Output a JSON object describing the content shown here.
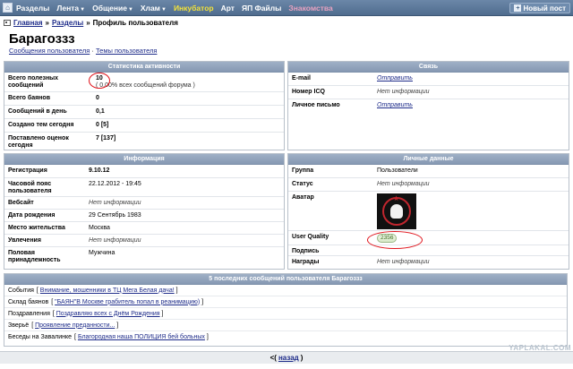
{
  "nav": {
    "items": [
      {
        "label": "Разделы",
        "caret": false,
        "style": "normal"
      },
      {
        "label": "Лента",
        "caret": true,
        "style": "normal"
      },
      {
        "label": "Общение",
        "caret": true,
        "style": "normal"
      },
      {
        "label": "Хлам",
        "caret": true,
        "style": "normal"
      },
      {
        "label": "Инкубатор",
        "caret": false,
        "style": "yellow"
      },
      {
        "label": "Арт",
        "caret": false,
        "style": "normal"
      },
      {
        "label": "ЯП Файлы",
        "caret": false,
        "style": "normal"
      },
      {
        "label": "Знакомства",
        "caret": false,
        "style": "pink"
      }
    ],
    "new_post": "Новый пост"
  },
  "breadcrumb": {
    "home": "Главная",
    "sections": "Разделы",
    "current": "Профиль пользователя",
    "separator": "»"
  },
  "profile": {
    "name": "Барагоззз",
    "tab_messages": "Сообщения пользователя",
    "tab_divider": "·",
    "tab_topics": "Темы пользователя"
  },
  "stats": {
    "title": "Статистика активности",
    "rows": [
      {
        "label": "Всего полезных сообщений",
        "value": "10",
        "extra": "( 0.00% всех сообщений форума )"
      },
      {
        "label": "Всего баянов",
        "value": "0"
      },
      {
        "label": "Сообщений в день",
        "value": "0,1"
      },
      {
        "label": "Создано тем сегодня",
        "value": "0 [5]"
      },
      {
        "label": "Поставлено оценок сегодня",
        "value": "7 [137]"
      }
    ]
  },
  "contact": {
    "title": "Связь",
    "rows": [
      {
        "label": "E-mail",
        "value": "Отправить",
        "link": true
      },
      {
        "label": "Номер ICQ",
        "value": "Нет информации",
        "link": false
      },
      {
        "label": "Личное письмо",
        "value": "Отправить",
        "link": true
      }
    ]
  },
  "info": {
    "title": "Информация",
    "rows": [
      {
        "label": "Регистрация",
        "value": "9.10.12",
        "bold": true
      },
      {
        "label": "Часовой пояс пользователя",
        "value": "22.12.2012 - 19:45"
      },
      {
        "label": "Вебсайт",
        "value": "Нет информации",
        "muted": true
      },
      {
        "label": "Дата рождения",
        "value": "29 Сентябрь 1983"
      },
      {
        "label": "Место жительства",
        "value": "Москва"
      },
      {
        "label": "Увлечения",
        "value": "Нет информации",
        "muted": true
      },
      {
        "label": "Половая принадлежность",
        "value": "Мужчина"
      }
    ]
  },
  "personal": {
    "title": "Личные данные",
    "group_label": "Группа",
    "group_value": "Пользователи",
    "status_label": "Статус",
    "status_value": "Нет информации",
    "avatar_label": "Аватар",
    "quality_label": "User Quality",
    "quality_value": "2356",
    "signature_label": "Подпись",
    "awards_label": "Награды",
    "awards_value": "Нет информации"
  },
  "posts": {
    "title": "5 последних сообщений пользователя Барагоззз",
    "items": [
      {
        "category": "События",
        "title": "Внимание, мошенники в ТЦ Мега Белая дача!"
      },
      {
        "category": "Склад баянов",
        "title": "\"БАЯН\"В Москве грабитель попал в реанимацию)"
      },
      {
        "category": "Поздравления",
        "title": "Поздравляю всех с Днём Рождения"
      },
      {
        "category": "Зверьё",
        "title": "Проявление преданности..."
      },
      {
        "category": "Беседы на Завалинке",
        "title": "Благородная наша ПОЛИЦИЯ бей больных"
      }
    ]
  },
  "pager": {
    "back": "<(",
    "link": "назад",
    "close": ")"
  },
  "watermark": "YAPLAKAL.COM",
  "colors": {
    "accent": "#4f6c8e",
    "header": "#8699b3",
    "highlight": "#e0131b"
  }
}
